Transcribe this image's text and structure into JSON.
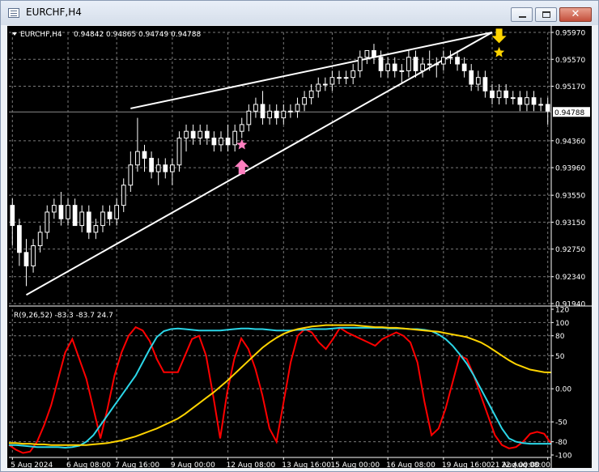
{
  "window": {
    "title": "EURCHF,H4",
    "minimize_glyph": "",
    "maximize_glyph": "",
    "close_glyph": "✕"
  },
  "colors": {
    "background": "#000000",
    "grid": "#7a7a7a",
    "bull_candle": "#ffffff",
    "bear_candle": "#ffffff",
    "trendline": "#ffffff",
    "rsi_red": "#ff0000",
    "rsi_cyan": "#2bd6e8",
    "rsi_yellow": "#ffd400",
    "arrow_up": "#ff7fc0",
    "arrow_down": "#ffd400"
  },
  "chart_data": [
    {
      "type": "candlestick",
      "title": "EURCHF,H4  0.94842 0.94865 0.94749 0.94788",
      "symbol": "EURCHF,H4",
      "ohlc_header": [
        "0.94842",
        "0.94865",
        "0.94749",
        "0.94788"
      ],
      "current_price": "0.94788",
      "ylim": [
        0.9194,
        0.9597
      ],
      "y_ticks": [
        "0.95970",
        "0.95570",
        "0.95170",
        "0.94788",
        "0.94360",
        "0.93960",
        "0.93550",
        "0.93150",
        "0.92750",
        "0.92340",
        "0.91940"
      ],
      "x_ticks": [
        "5 Aug 2024",
        "6 Aug 08:00",
        "7 Aug 16:00",
        "9 Aug 00:00",
        "12 Aug 08:00",
        "13 Aug 16:00",
        "15 Aug 00:00",
        "16 Aug 08:00",
        "19 Aug 16:00",
        "21 Aug 00:00",
        "22 Aug 08:00"
      ],
      "grid": true,
      "candles": [
        [
          0.934,
          0.935,
          0.928,
          0.931
        ],
        [
          0.931,
          0.932,
          0.925,
          0.927
        ],
        [
          0.927,
          0.929,
          0.922,
          0.925
        ],
        [
          0.925,
          0.929,
          0.924,
          0.928
        ],
        [
          0.928,
          0.931,
          0.927,
          0.93
        ],
        [
          0.93,
          0.934,
          0.929,
          0.933
        ],
        [
          0.933,
          0.935,
          0.932,
          0.934
        ],
        [
          0.934,
          0.936,
          0.931,
          0.932
        ],
        [
          0.932,
          0.935,
          0.931,
          0.934
        ],
        [
          0.934,
          0.935,
          0.931,
          0.931
        ],
        [
          0.931,
          0.934,
          0.93,
          0.933
        ],
        [
          0.933,
          0.934,
          0.929,
          0.93
        ],
        [
          0.93,
          0.932,
          0.929,
          0.931
        ],
        [
          0.931,
          0.934,
          0.93,
          0.933
        ],
        [
          0.933,
          0.934,
          0.931,
          0.932
        ],
        [
          0.932,
          0.935,
          0.931,
          0.934
        ],
        [
          0.934,
          0.938,
          0.933,
          0.937
        ],
        [
          0.937,
          0.942,
          0.936,
          0.94
        ],
        [
          0.94,
          0.947,
          0.939,
          0.942
        ],
        [
          0.942,
          0.943,
          0.939,
          0.941
        ],
        [
          0.941,
          0.942,
          0.938,
          0.939
        ],
        [
          0.939,
          0.941,
          0.937,
          0.94
        ],
        [
          0.94,
          0.941,
          0.938,
          0.939
        ],
        [
          0.939,
          0.941,
          0.937,
          0.94
        ],
        [
          0.94,
          0.945,
          0.939,
          0.944
        ],
        [
          0.944,
          0.946,
          0.942,
          0.945
        ],
        [
          0.945,
          0.946,
          0.943,
          0.944
        ],
        [
          0.944,
          0.946,
          0.943,
          0.945
        ],
        [
          0.945,
          0.946,
          0.943,
          0.944
        ],
        [
          0.944,
          0.945,
          0.942,
          0.943
        ],
        [
          0.943,
          0.945,
          0.942,
          0.944
        ],
        [
          0.944,
          0.946,
          0.942,
          0.943
        ],
        [
          0.943,
          0.946,
          0.942,
          0.945
        ],
        [
          0.945,
          0.947,
          0.944,
          0.946
        ],
        [
          0.946,
          0.949,
          0.945,
          0.948
        ],
        [
          0.948,
          0.95,
          0.947,
          0.949
        ],
        [
          0.949,
          0.951,
          0.946,
          0.947
        ],
        [
          0.947,
          0.949,
          0.946,
          0.948
        ],
        [
          0.948,
          0.949,
          0.946,
          0.947
        ],
        [
          0.947,
          0.949,
          0.946,
          0.948
        ],
        [
          0.948,
          0.949,
          0.947,
          0.948
        ],
        [
          0.948,
          0.95,
          0.947,
          0.949
        ],
        [
          0.949,
          0.951,
          0.948,
          0.95
        ],
        [
          0.95,
          0.952,
          0.949,
          0.951
        ],
        [
          0.951,
          0.953,
          0.95,
          0.952
        ],
        [
          0.952,
          0.953,
          0.951,
          0.952
        ],
        [
          0.952,
          0.954,
          0.951,
          0.953
        ],
        [
          0.953,
          0.954,
          0.952,
          0.953
        ],
        [
          0.953,
          0.954,
          0.952,
          0.953
        ],
        [
          0.953,
          0.955,
          0.952,
          0.954
        ],
        [
          0.954,
          0.957,
          0.953,
          0.956
        ],
        [
          0.956,
          0.957,
          0.955,
          0.957
        ],
        [
          0.957,
          0.958,
          0.955,
          0.956
        ],
        [
          0.956,
          0.957,
          0.953,
          0.954
        ],
        [
          0.954,
          0.956,
          0.953,
          0.955
        ],
        [
          0.955,
          0.956,
          0.953,
          0.954
        ],
        [
          0.954,
          0.955,
          0.952,
          0.954
        ],
        [
          0.954,
          0.957,
          0.953,
          0.956
        ],
        [
          0.956,
          0.957,
          0.953,
          0.954
        ],
        [
          0.954,
          0.956,
          0.953,
          0.955
        ],
        [
          0.955,
          0.957,
          0.954,
          0.955
        ],
        [
          0.955,
          0.956,
          0.953,
          0.955
        ],
        [
          0.955,
          0.957,
          0.954,
          0.956
        ],
        [
          0.956,
          0.957,
          0.955,
          0.956
        ],
        [
          0.956,
          0.957,
          0.954,
          0.955
        ],
        [
          0.955,
          0.956,
          0.953,
          0.954
        ],
        [
          0.954,
          0.955,
          0.951,
          0.952
        ],
        [
          0.952,
          0.954,
          0.951,
          0.953
        ],
        [
          0.953,
          0.954,
          0.95,
          0.951
        ],
        [
          0.951,
          0.952,
          0.949,
          0.95
        ],
        [
          0.95,
          0.952,
          0.949,
          0.951
        ],
        [
          0.951,
          0.952,
          0.949,
          0.95
        ],
        [
          0.95,
          0.951,
          0.949,
          0.95
        ],
        [
          0.95,
          0.951,
          0.948,
          0.949
        ],
        [
          0.949,
          0.951,
          0.948,
          0.95
        ],
        [
          0.95,
          0.951,
          0.948,
          0.949
        ],
        [
          0.949,
          0.95,
          0.948,
          0.949
        ],
        [
          0.949,
          0.95,
          0.946,
          0.948
        ]
      ],
      "trendlines": [
        {
          "name": "upper",
          "points": [
            [
              17,
              0.9484
            ],
            [
              69,
              0.9597
            ]
          ]
        },
        {
          "name": "lower",
          "points": [
            [
              2,
              0.9207
            ],
            [
              69,
              0.9597
            ]
          ]
        }
      ],
      "markers": [
        {
          "type": "arrow-up",
          "index": 33,
          "price": 0.9396,
          "color": "#ff7fc0"
        },
        {
          "type": "star",
          "index": 33,
          "price": 0.943,
          "color": "#ff7fc0"
        },
        {
          "type": "arrow-down",
          "index": 70,
          "price": 0.9593,
          "color": "#ffd400"
        },
        {
          "type": "star",
          "index": 70,
          "price": 0.9567,
          "color": "#ffd400"
        }
      ]
    },
    {
      "type": "line",
      "title": "R(9,26,52) -83.3 -83.7 24.7",
      "indicator_header": "R(9,26,52) -83.3 -83.7 24.7",
      "ylim": [
        -100,
        120
      ],
      "y_ticks": [
        "120",
        "100",
        "80",
        "50",
        "0.00",
        "-50",
        "-80",
        "-100"
      ],
      "grid": true,
      "series": [
        {
          "color": "#ff0000",
          "values": [
            -85,
            -92,
            -97,
            -95,
            -80,
            -55,
            -25,
            15,
            55,
            75,
            45,
            15,
            -30,
            -75,
            -30,
            20,
            55,
            80,
            93,
            88,
            72,
            45,
            25,
            25,
            25,
            50,
            75,
            80,
            50,
            -10,
            -75,
            -5,
            45,
            76,
            60,
            30,
            -10,
            -60,
            -80,
            -20,
            40,
            80,
            90,
            85,
            70,
            60,
            75,
            92,
            85,
            80,
            75,
            70,
            65,
            75,
            80,
            85,
            80,
            70,
            40,
            -20,
            -70,
            -60,
            -30,
            10,
            50,
            45,
            20,
            -10,
            -40,
            -70,
            -85,
            -90,
            -88,
            -80,
            -68,
            -65,
            -68,
            -83
          ]
        },
        {
          "color": "#2bd6e8",
          "values": [
            -85,
            -85,
            -86,
            -87,
            -88,
            -88,
            -88,
            -88,
            -89,
            -88,
            -86,
            -80,
            -70,
            -55,
            -40,
            -25,
            -10,
            5,
            20,
            40,
            60,
            78,
            87,
            90,
            91,
            90,
            89,
            88,
            88,
            88,
            88,
            89,
            90,
            91,
            91,
            90,
            90,
            89,
            88,
            88,
            88,
            89,
            89,
            90,
            90,
            90,
            91,
            92,
            92,
            92,
            92,
            92,
            92,
            92,
            91,
            91,
            91,
            90,
            90,
            89,
            87,
            82,
            75,
            65,
            52,
            38,
            20,
            0,
            -20,
            -40,
            -60,
            -75,
            -80,
            -82,
            -83,
            -83,
            -83,
            -83
          ]
        },
        {
          "color": "#ffd400",
          "values": [
            -82,
            -82,
            -83,
            -83,
            -84,
            -84,
            -85,
            -85,
            -85,
            -85,
            -85,
            -85,
            -84,
            -83,
            -82,
            -80,
            -78,
            -75,
            -72,
            -68,
            -64,
            -60,
            -55,
            -50,
            -45,
            -38,
            -30,
            -22,
            -14,
            -6,
            3,
            12,
            22,
            32,
            42,
            52,
            62,
            70,
            77,
            83,
            87,
            90,
            92,
            94,
            95,
            96,
            96,
            96,
            96,
            96,
            95,
            94,
            93,
            93,
            92,
            92,
            91,
            90,
            89,
            88,
            87,
            86,
            84,
            82,
            80,
            78,
            74,
            70,
            64,
            57,
            50,
            43,
            37,
            33,
            29,
            27,
            25,
            24.7
          ]
        }
      ]
    }
  ]
}
